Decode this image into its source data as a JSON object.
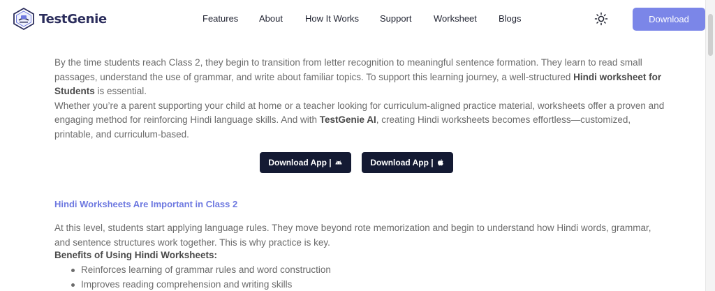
{
  "brand": {
    "name": "TestGenie",
    "accent": "#7b86e8",
    "dark": "#141a33",
    "section_color": "#6e79e0"
  },
  "nav": {
    "items": [
      {
        "label": "Features"
      },
      {
        "label": "About"
      },
      {
        "label": "How It Works"
      },
      {
        "label": "Support"
      },
      {
        "label": "Worksheet"
      },
      {
        "label": "Blogs"
      }
    ],
    "theme_icon": "sun-icon",
    "download_label": "Download"
  },
  "intro": {
    "p1_a": "By the time students reach Class 2, they begin to transition from letter recognition to meaningful sentence formation. They learn to read small passages, understand the use of grammar, and write about familiar topics. To support this learning journey, a well-structured ",
    "p1_bold": "Hindi worksheet for Students",
    "p1_b": " is essential.",
    "p2_a": "Whether you’re a parent supporting your child at home or a teacher looking for curriculum-aligned practice material, worksheets offer a proven and engaging method for reinforcing Hindi language skills. And with ",
    "p2_bold": "TestGenie AI",
    "p2_b": ", creating Hindi worksheets becomes effortless—customized, printable, and curriculum-based."
  },
  "app_buttons": [
    {
      "label": "Download App |",
      "icon": "android-icon"
    },
    {
      "label": "Download App |",
      "icon": "apple-icon"
    }
  ],
  "section": {
    "title": "Hindi Worksheets Are Important in Class 2",
    "para": "At this level, students start applying language rules. They move beyond rote memorization and begin to understand how Hindi words, grammar, and sentence structures work together. This is why practice is key.",
    "benefits_title": "Benefits of Using Hindi Worksheets:",
    "benefits": [
      "Reinforces learning of grammar rules and word construction",
      "Improves reading comprehension and writing skills"
    ]
  }
}
